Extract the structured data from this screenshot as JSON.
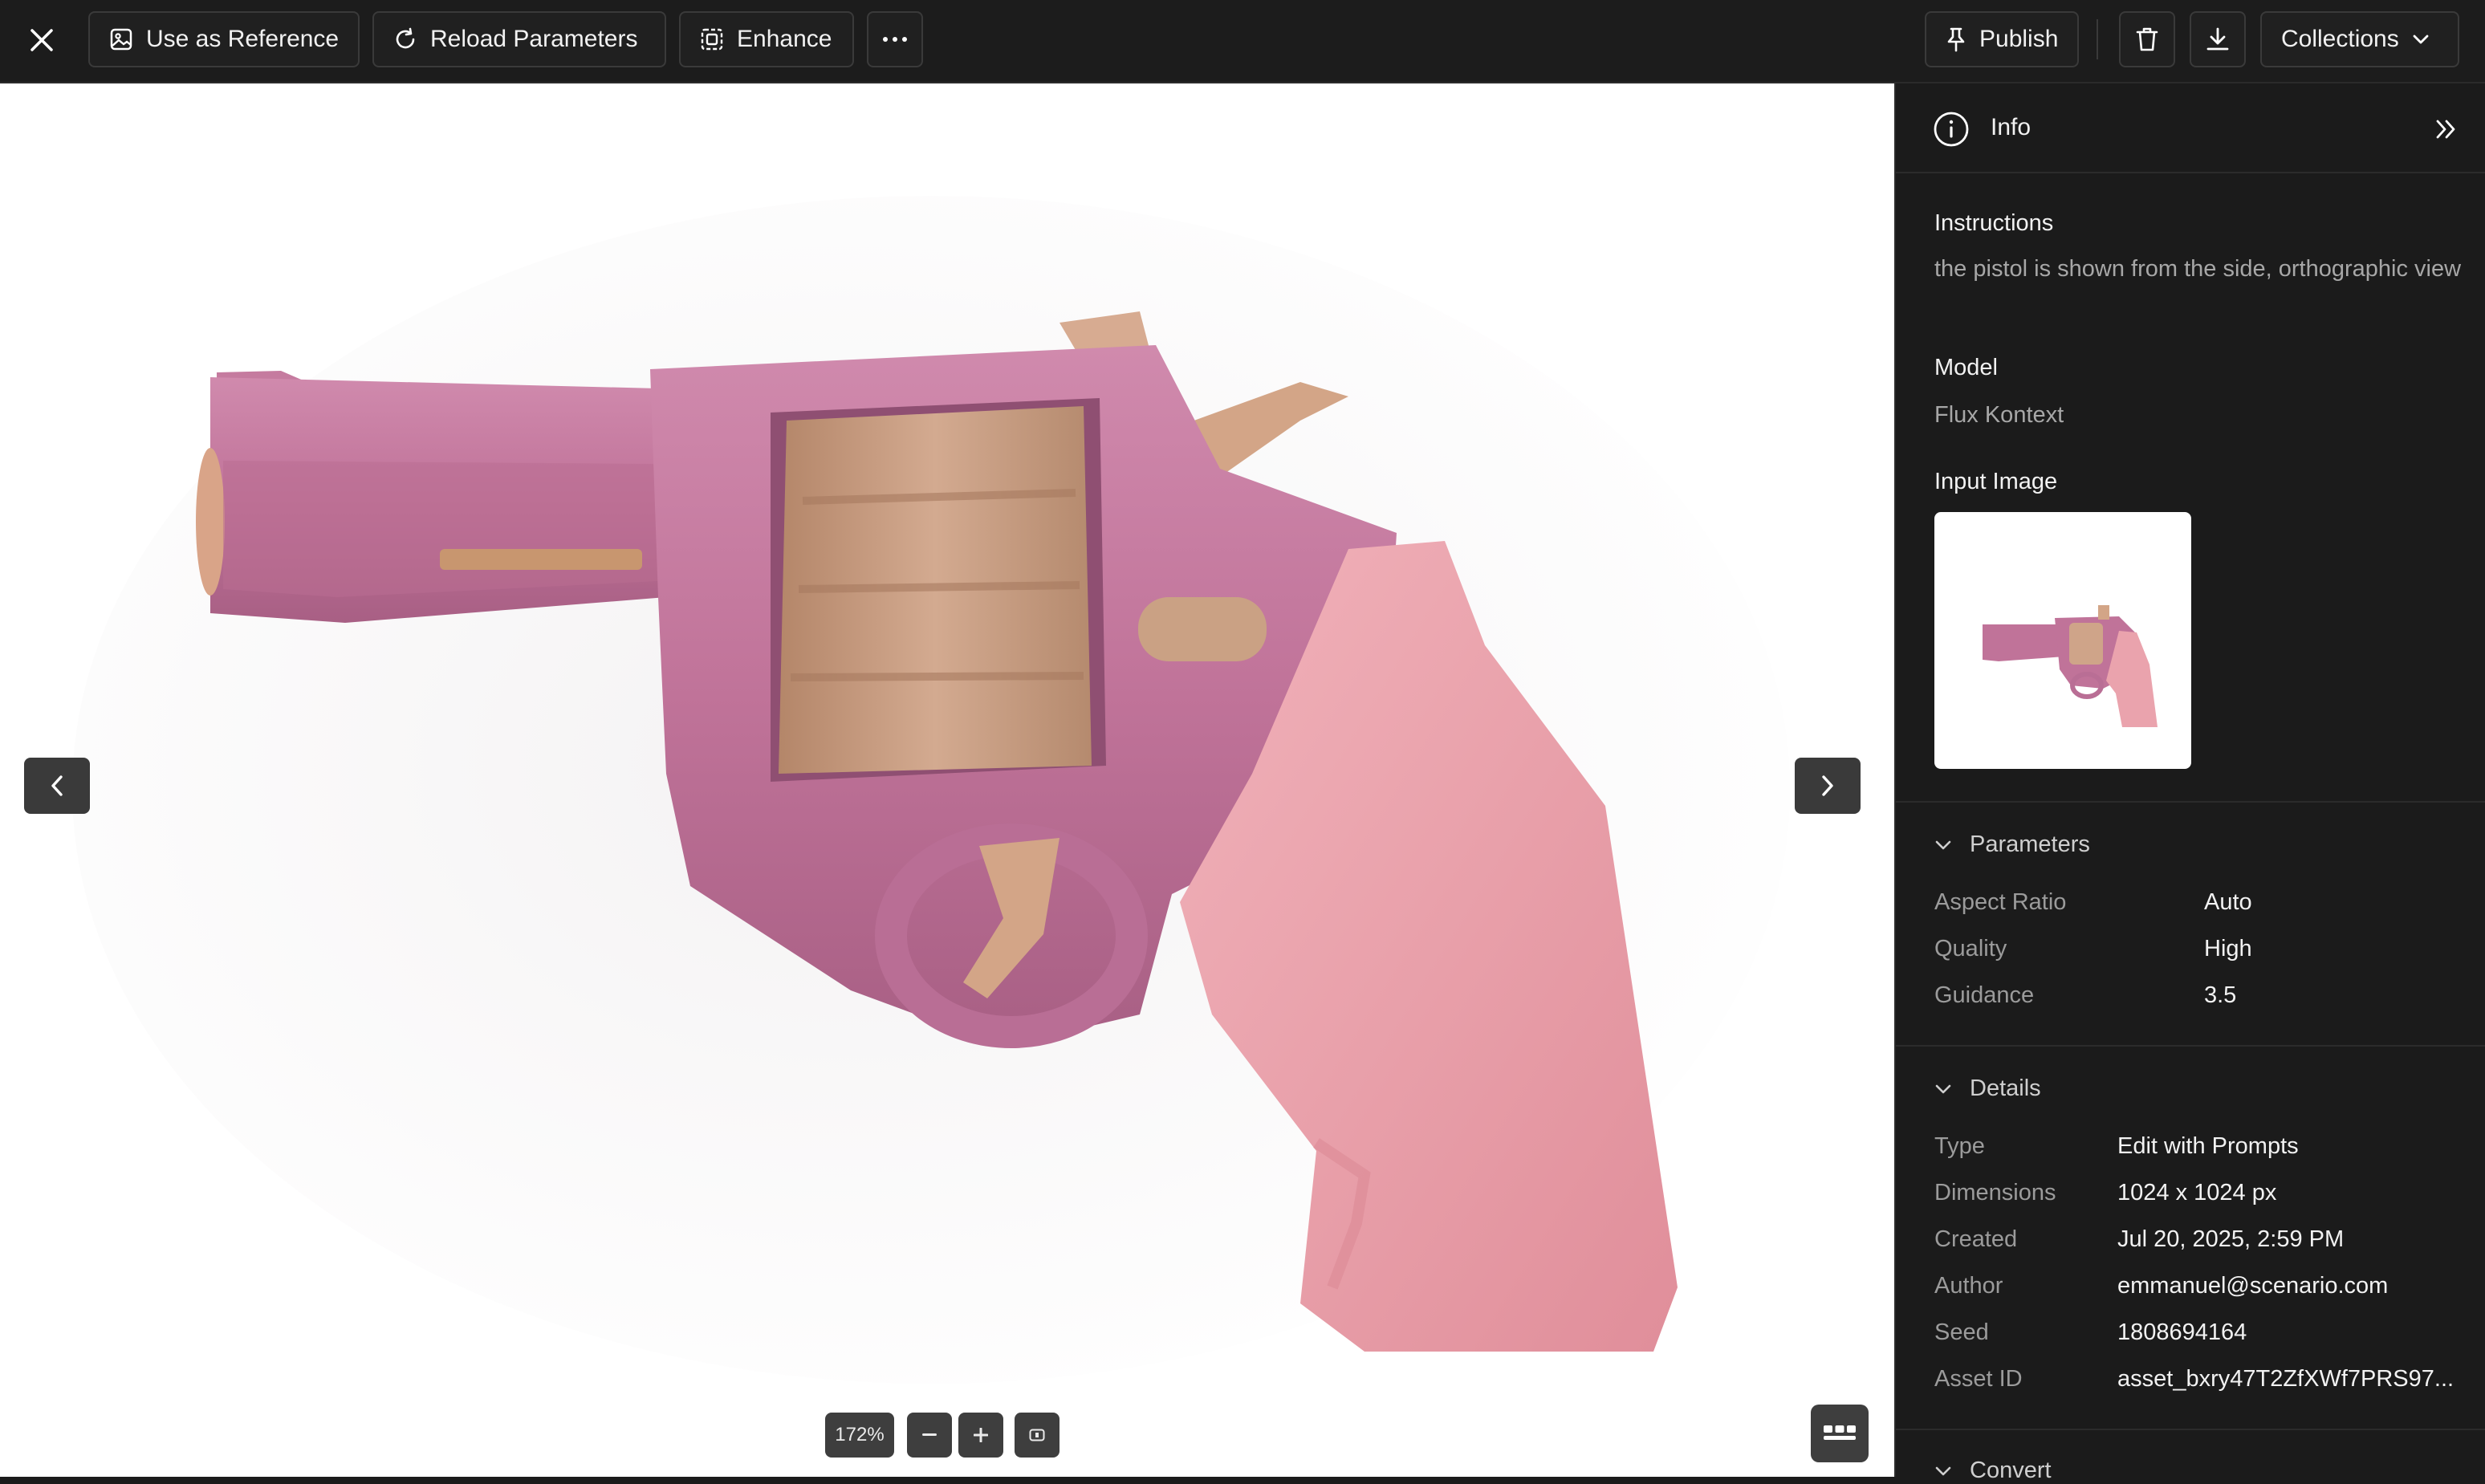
{
  "toolbar": {
    "use_as_reference": "Use as Reference",
    "reload_parameters": "Reload Parameters",
    "enhance": "Enhance",
    "publish": "Publish",
    "collections": "Collections"
  },
  "viewer": {
    "zoom_level": "172%"
  },
  "panel": {
    "title": "Info",
    "instructions_label": "Instructions",
    "instructions_text": "the pistol is shown from the side, orthographic view",
    "model_label": "Model",
    "model_value": "Flux Kontext",
    "input_image_label": "Input Image",
    "parameters": {
      "heading": "Parameters",
      "rows": [
        {
          "key": "Aspect Ratio",
          "value": "Auto"
        },
        {
          "key": "Quality",
          "value": "High"
        },
        {
          "key": "Guidance",
          "value": "3.5"
        }
      ]
    },
    "details": {
      "heading": "Details",
      "rows": [
        {
          "key": "Type",
          "value": "Edit with Prompts"
        },
        {
          "key": "Dimensions",
          "value": "1024 x 1024 px"
        },
        {
          "key": "Created",
          "value": "Jul 20, 2025, 2:59 PM"
        },
        {
          "key": "Author",
          "value": "emmanuel@scenario.com"
        },
        {
          "key": "Seed",
          "value": "1808694164"
        },
        {
          "key": "Asset ID",
          "value": "asset_bxry47T2ZfXWf7PRS97..."
        }
      ]
    },
    "convert_heading": "Convert"
  },
  "colors": {
    "toolbar_bg": "#1c1c1c",
    "panel_bg": "#1b1b1b",
    "revolver_frame": "#c47a9e",
    "revolver_grip": "#e9a1aa",
    "revolver_accent": "#c9997c"
  }
}
